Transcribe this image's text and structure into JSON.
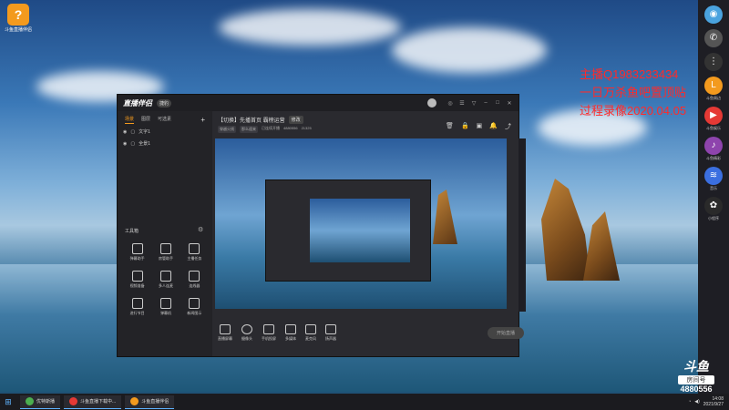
{
  "desktop": {
    "icon_label": "斗鱼直播伴侣"
  },
  "overlay": {
    "lines": [
      "主播Q1983233434",
      "一日万杀鱼吧置顶贴",
      "过程录像2020.04.05"
    ],
    "color": "#ff2a2a"
  },
  "app": {
    "logo": "直播伴侣",
    "version_badge": "捷豹",
    "left_tabs": [
      "场景",
      "图层",
      "可选素"
    ],
    "scenes": [
      "文字1",
      "全景1"
    ],
    "tools_header": "工具箱",
    "tools": [
      "弹幕助手",
      "房管助手",
      "主播任务",
      "视频准备",
      "多人连麦",
      "连线器",
      "进行节目",
      "弹幕机",
      "新闻图示"
    ],
    "room_title": "【切换】先播首页 霸榜运营",
    "room_title_button": "修改",
    "room_meta": [
      "穿越火线",
      "那么遥来",
      "已连续开播",
      "4880556",
      "21325"
    ],
    "bottom_tools": [
      "直播屏幕",
      "摄像头",
      "手机投屏",
      "多媒体",
      "麦克风",
      "扬声器"
    ],
    "go_live": "开始直播"
  },
  "right_bar": {
    "items": [
      {
        "label": "",
        "icon": "browser-icon",
        "color": "#4aa3df"
      },
      {
        "label": "",
        "icon": "phone-icon",
        "color": "#555"
      },
      {
        "label": "",
        "icon": "menu-dots-icon",
        "color": "#333"
      },
      {
        "label": "斗鱼周边",
        "icon": "doudou-icon",
        "color": "#f39a1e"
      },
      {
        "label": "斗鱼娱乐",
        "icon": "live-icon",
        "color": "#e53935"
      },
      {
        "label": "斗鱼精彩",
        "icon": "music-icon",
        "color": "#8e44ad"
      },
      {
        "label": "音乐",
        "icon": "audio-icon",
        "color": "#3b6fe0"
      },
      {
        "label": "小程序",
        "icon": "apps-icon",
        "color": "#2a2a2a"
      }
    ]
  },
  "watermark": {
    "logo": "斗鱼",
    "room_label": "房间号",
    "room_number": "4880556"
  },
  "taskbar": {
    "apps": [
      {
        "label": "优特斯播",
        "color": "#4caf50"
      },
      {
        "label": "斗鱼直播下载中...",
        "color": "#e53935"
      },
      {
        "label": "斗鱼直播伴侣",
        "color": "#f39a1e"
      }
    ],
    "time": "14:08",
    "date": "2021/9/27"
  }
}
